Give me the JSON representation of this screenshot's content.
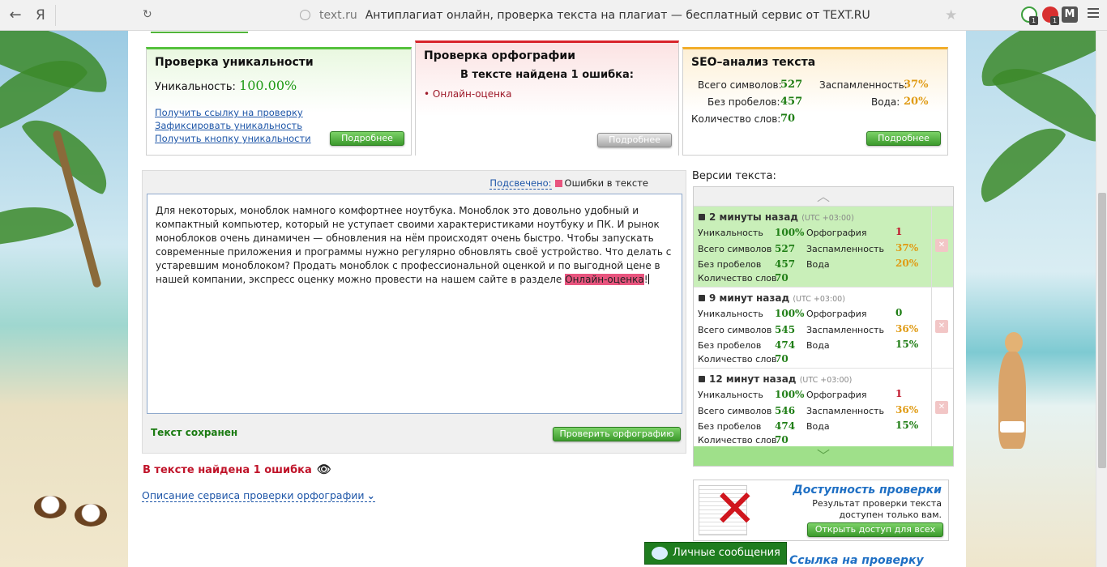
{
  "browser": {
    "logo": "Я",
    "host": "text.ru",
    "title": "Антиплагиат онлайн, проверка текста на плагиат — бесплатный сервис от TEXT.RU",
    "ext_badges": [
      "1",
      "1"
    ],
    "ext3_label": "M"
  },
  "uniqueness": {
    "title": "Проверка уникальности",
    "label": "Уникальность:",
    "value": "100.00%",
    "links": [
      "Получить ссылку на проверку",
      "Зафиксировать уникальность",
      "Получить кнопку уникальности"
    ],
    "more": "Подробнее"
  },
  "spelling": {
    "title": "Проверка орфографии",
    "subtitle": "В тексте найдена 1 ошибка:",
    "items": [
      "Онлайн-оценка"
    ],
    "more": "Подробнее"
  },
  "seo": {
    "title": "SEO–анализ текста",
    "chars_label": "Всего символов:",
    "chars_value": "527",
    "nospace_label": "Без пробелов:",
    "nospace_value": "457",
    "words_label": "Количество слов:",
    "words_value": "70",
    "spam_label": "Заспамленность:",
    "spam_value": "37%",
    "water_label": "Вода:",
    "water_value": "20%",
    "more": "Подробнее"
  },
  "editor": {
    "legend_link": "Подсвечено:",
    "legend_text": "Ошибки в тексте",
    "text_before": "Для некоторых, моноблок намного комфортнее ноутбука. Моноблок это довольно удобный и компактный компьютер, который не уступает своими характеристиками ноутбуку и ПК. И рынок моноблоков очень динамичен — обновления на нём происходят очень быстро. Чтобы запускать современные приложения и программы нужно регулярно обновлять своё устройство. Что делать с устаревшим моноблоком? Продать моноблок с профессиональной оценкой и по выгодной цене в нашей компании, экспресс оценку можно провести на нашем сайте в разделе ",
    "error_word": "Онлайн-оценка",
    "text_after": "!",
    "saved": "Текст сохранен",
    "check_button": "Проверить орфографию"
  },
  "found": "В тексте найдена 1 ошибка",
  "description_link": "Описание сервиса проверки орфографии",
  "versions": {
    "title": "Версии текста:",
    "labels": {
      "uniq": "Уникальность",
      "chars": "Всего символов",
      "nospace": "Без пробелов",
      "words": "Количество слов",
      "spell": "Орфография",
      "spam": "Заспамленность",
      "water": "Вода"
    },
    "items": [
      {
        "time": "2 минуты назад",
        "tz": "(UTC +03:00)",
        "uniq": "100%",
        "chars": "527",
        "nospace": "457",
        "words": "70",
        "spell": "1",
        "spam": "37%",
        "water": "20%"
      },
      {
        "time": "9 минут назад",
        "tz": "(UTC +03:00)",
        "uniq": "100%",
        "chars": "545",
        "nospace": "474",
        "words": "70",
        "spell": "0",
        "spam": "36%",
        "water": "15%"
      },
      {
        "time": "12 минут назад",
        "tz": "(UTC +03:00)",
        "uniq": "100%",
        "chars": "546",
        "nospace": "474",
        "words": "70",
        "spell": "1",
        "spam": "36%",
        "water": "15%"
      }
    ]
  },
  "access": {
    "title": "Доступность проверки",
    "text": "Результат проверки текста доступен только вам.",
    "button": "Открыть доступ для всех",
    "next_title": "Ссылка на проверку"
  },
  "messages": "Личные сообщения"
}
